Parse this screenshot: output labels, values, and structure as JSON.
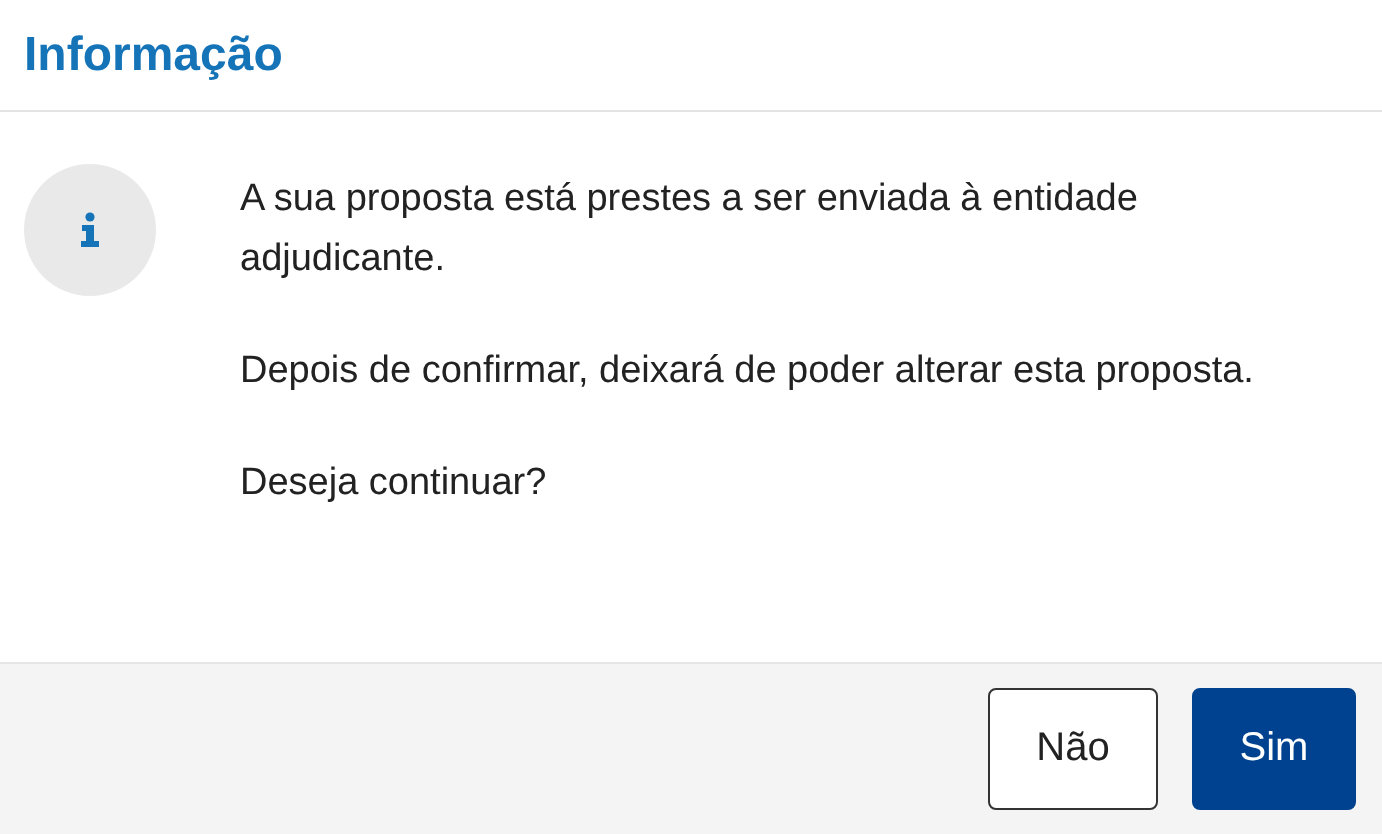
{
  "dialog": {
    "title": "Informação",
    "paragraphs": [
      "A sua proposta está prestes a ser enviada à entidade adjudicante.",
      "Depois de confirmar, deixará de poder alterar esta proposta.",
      "Deseja continuar?"
    ],
    "buttons": [
      {
        "label": "Não",
        "kind": "secondary"
      },
      {
        "label": "Sim",
        "kind": "primary"
      }
    ]
  }
}
